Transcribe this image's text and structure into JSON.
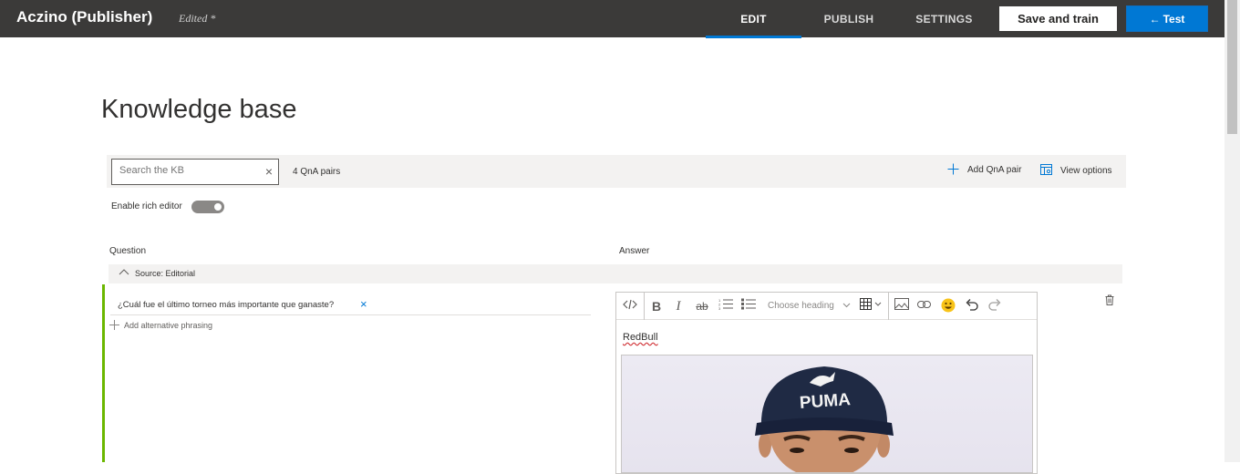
{
  "topbar": {
    "app_title": "Aczino (Publisher)",
    "edited_label": "Edited *",
    "tabs": [
      {
        "label": "EDIT",
        "active": true
      },
      {
        "label": "PUBLISH",
        "active": false
      },
      {
        "label": "SETTINGS",
        "active": false
      }
    ],
    "save_train_label": "Save and train",
    "test_label": "Test",
    "test_arrow": "←"
  },
  "page": {
    "title": "Knowledge base"
  },
  "kb_toolbar": {
    "search_placeholder": "Search the KB",
    "search_value": "",
    "qna_count": "4 QnA pairs",
    "add_qna_label": "Add QnA pair",
    "view_options_label": "View options"
  },
  "rich_editor": {
    "label": "Enable rich editor",
    "enabled": true
  },
  "columns": {
    "question": "Question",
    "answer": "Answer"
  },
  "source": {
    "label": "Source: Editorial"
  },
  "qna_pair": {
    "question": "¿Cuál fue el último torneo más importante que ganaste?",
    "add_alternative_label": "Add alternative phrasing",
    "answer_text": "RedBull",
    "heading_select_label": "Choose heading",
    "image_cap_text": "PUMA"
  },
  "colors": {
    "topbar_bg": "#3b3a39",
    "accent_blue": "#0078d4",
    "source_green": "#6bb700",
    "toolbar_bg": "#f3f2f1"
  },
  "icons": {
    "search_clear": "×",
    "question_remove": "×"
  }
}
